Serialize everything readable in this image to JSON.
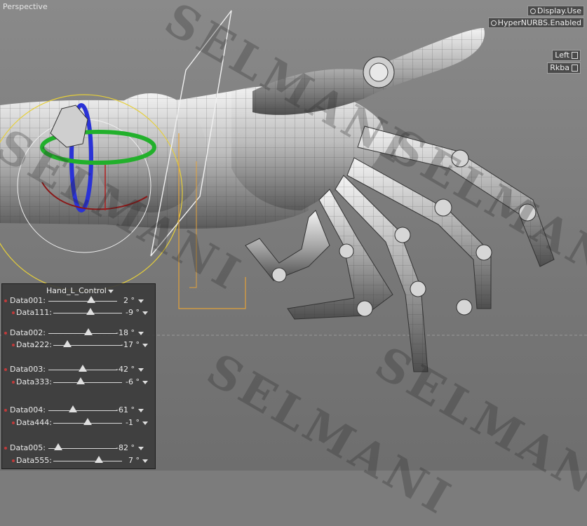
{
  "viewport": {
    "title": "Perspective",
    "hud": {
      "display_use": "Display.Use",
      "hypernurbs": "HyperNURBS.Enabled"
    },
    "camera_buttons": [
      "Left",
      "Rkba"
    ],
    "watermark": "SELMANI"
  },
  "panel": {
    "title": "Hand_L_Control",
    "groups": [
      {
        "main": {
          "label": "Data001:",
          "value": "2 °",
          "level": 0.62
        },
        "sub": {
          "label": "Data111:",
          "value": "-9 °",
          "level": 0.54
        }
      },
      {
        "main": {
          "label": "Data002:",
          "value": "-18 °",
          "level": 0.58
        },
        "sub": {
          "label": "Data222:",
          "value": "-17 °",
          "level": 0.2
        }
      },
      {
        "main": {
          "label": "Data003:",
          "value": "-42 °",
          "level": 0.5
        },
        "sub": {
          "label": "Data333:",
          "value": "-6 °",
          "level": 0.4
        }
      },
      {
        "main": {
          "label": "Data004:",
          "value": "-61 °",
          "level": 0.36
        },
        "sub": {
          "label": "Data444:",
          "value": "-1 °",
          "level": 0.5
        }
      },
      {
        "main": {
          "label": "Data005:",
          "value": "-82 °",
          "level": 0.14
        },
        "sub": {
          "label": "Data555:",
          "value": "7 °",
          "level": 0.66
        }
      }
    ]
  }
}
